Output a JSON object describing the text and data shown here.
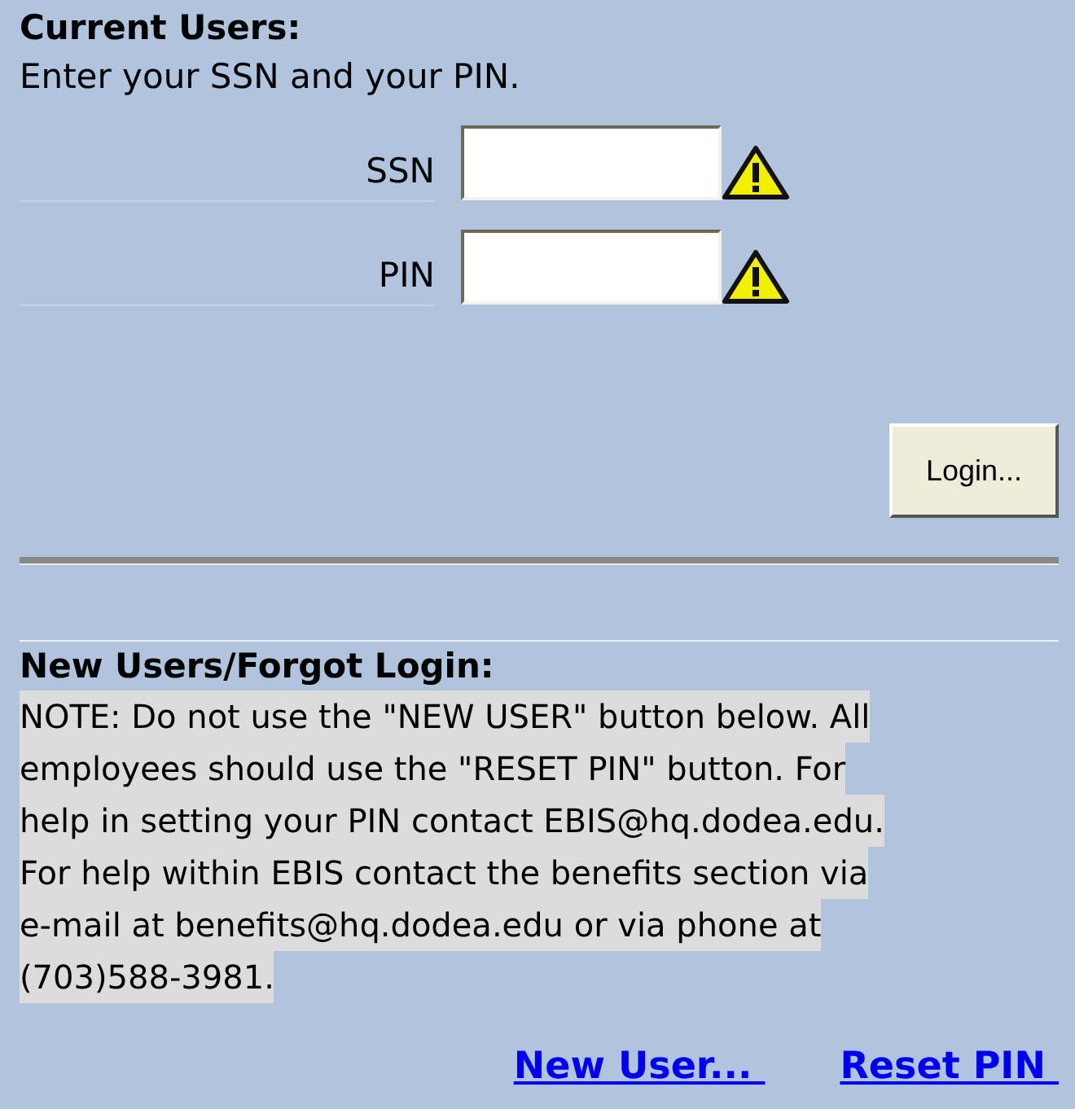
{
  "current_users": {
    "title": "Current Users:",
    "instructions": "Enter your SSN and your PIN.",
    "fields": [
      {
        "label": "SSN",
        "warning": true
      },
      {
        "label": "PIN",
        "warning": true
      }
    ],
    "login_button": "Login..."
  },
  "new_users": {
    "title": "New Users/Forgot Login:",
    "note_lines": [
      "NOTE: Do not use the \"NEW USER\" button below. All",
      "employees should use the \"RESET PIN\" button. For",
      "help in setting your PIN contact EBIS@hq.dodea.edu.",
      "For help within EBIS contact the benefits section via",
      "e-mail at benefits@hq.dodea.edu or via phone at",
      "(703)588-3981."
    ],
    "links": [
      "New User... ",
      "Reset PIN "
    ]
  }
}
